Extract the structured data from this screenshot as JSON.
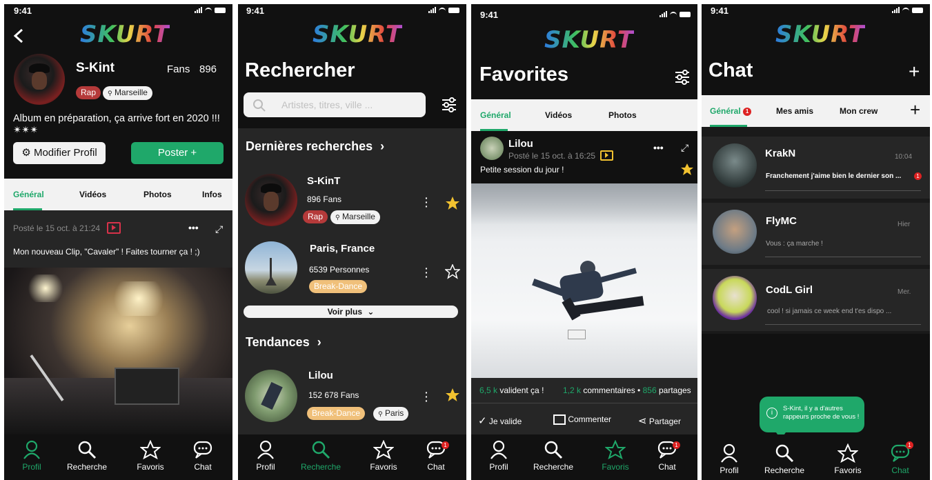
{
  "status_time": "9:41",
  "logo": "SKURT",
  "profile": {
    "name": "S-Kint",
    "fans_label": "Fans",
    "fans_count": "896",
    "tag_genre": "Rap",
    "tag_city": "Marseille",
    "bio": "Album en préparation, ça arrive fort en 2020 !!! ✴✴✴",
    "edit_label": "Modifier Profil",
    "post_label": "Poster +",
    "tabs": [
      "Général",
      "Vidéos",
      "Photos",
      "Infos"
    ],
    "post_meta": "Posté le 15 oct. à 21:24",
    "post_text": "Mon nouveau Clip, \"Cavaler\" ! Faites tourner ça ! ;)"
  },
  "search": {
    "title": "Rechercher",
    "placeholder": "Artistes, titres, ville ...",
    "recent_heading": "Dernières recherches",
    "results": [
      {
        "name": "S-KinT",
        "sub": "896 Fans",
        "tag1": "Rap",
        "tag2": "Marseille"
      },
      {
        "name": "Paris, France",
        "sub": "6539 Personnes",
        "tag1": "Break-Dance"
      }
    ],
    "more_label": "Voir plus",
    "trends_heading": "Tendances",
    "trend": {
      "name": "Lilou",
      "sub": "152 678 Fans",
      "tag1": "Break-Dance",
      "tag2": "Paris"
    }
  },
  "favorites": {
    "title": "Favorites",
    "tabs": [
      "Général",
      "Vidéos",
      "Photos"
    ],
    "post_author": "Lilou",
    "post_meta": "Posté le 15 oct. à 16:25",
    "post_text": "Petite session du jour !",
    "stat_likes_num": "6,5 k",
    "stat_likes_label": "valident ça !",
    "stat_comments_num": "1,2 k",
    "stat_comments_label": "commentaires •",
    "stat_shares_num": "856",
    "stat_shares_label": "partages",
    "action_like": "Je valide",
    "action_comment": "Commenter",
    "action_share": "Partager"
  },
  "chat": {
    "title": "Chat",
    "tabs": [
      "Général",
      "Mes amis",
      "Mon crew"
    ],
    "tab_badge": "1",
    "conversations": [
      {
        "name": "KrakN",
        "time": "10:04",
        "preview": "Franchement j'aime bien le dernier son ..."
      },
      {
        "name": "FlyMC",
        "time": "Hier",
        "preview": "Vous : ça marche !"
      },
      {
        "name": "CodL Girl",
        "time": "Mer.",
        "preview": "cool ! si jamais ce week end t'es dispo ..."
      }
    ],
    "unread_badge": "1",
    "tooltip": "S-Kint, il y a d'autres rappeurs proche de vous !"
  },
  "nav": {
    "labels": [
      "Profil",
      "Recherche",
      "Favoris",
      "Chat"
    ],
    "chat_badge": "1"
  },
  "colors": {
    "accent": "#1fa86a",
    "rap_tag": "#b53a3a",
    "break_tag": "#f0c07a",
    "background": "#262626"
  }
}
